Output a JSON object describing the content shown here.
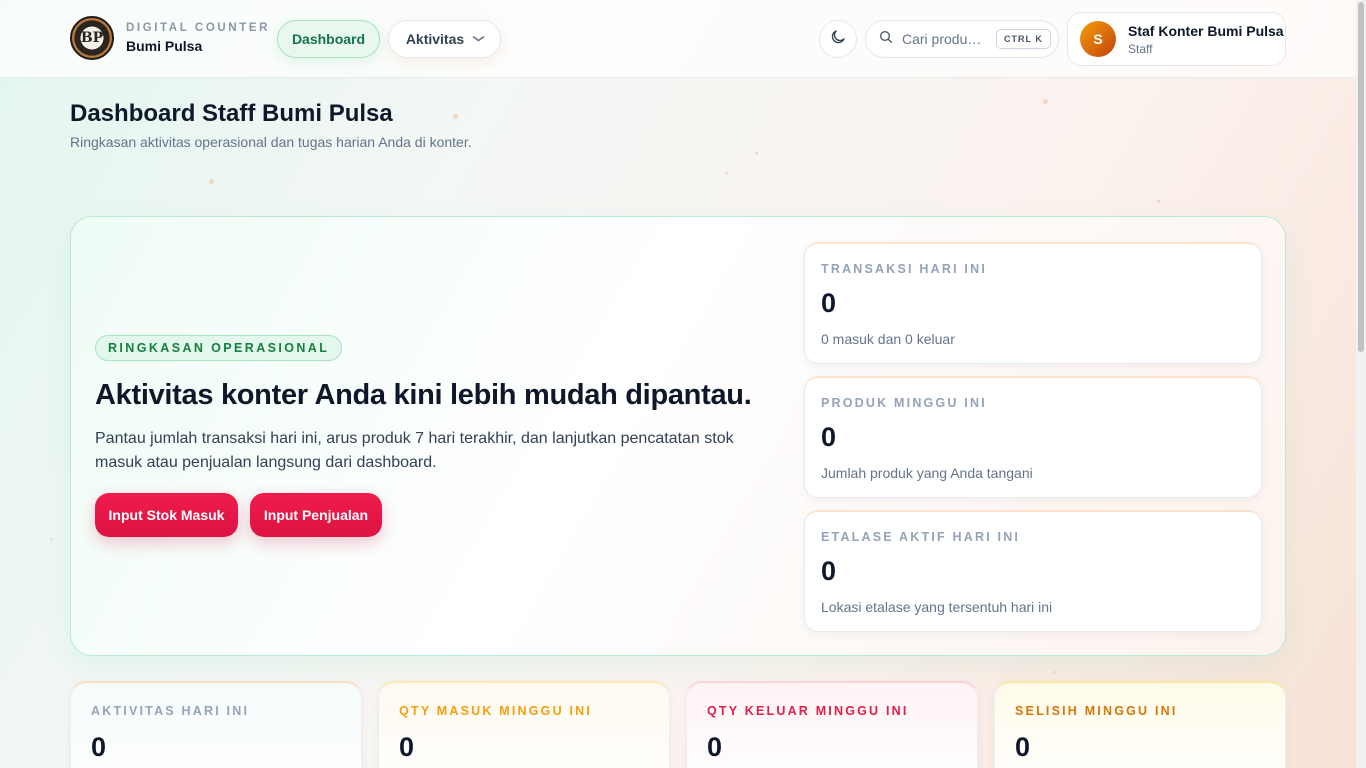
{
  "colors": {
    "accent_green": "#157347",
    "cta_red": "#e11d48",
    "card_orange": "#f59e0b",
    "card_red": "#e11d48",
    "card_amber": "#d97706"
  },
  "header": {
    "brand": {
      "logo_text": "BP",
      "subtitle": "DIGITAL COUNTER",
      "name": "Bumi Pulsa",
      "logo_icon": "bumi-pulsa-logo"
    },
    "nav": {
      "dashboard_label": "Dashboard",
      "aktivitas_label": "Aktivitas",
      "aktivitas_icon": "chevron-down-icon"
    },
    "theme_toggle_icon": "moon-icon",
    "search": {
      "icon": "search-icon",
      "placeholder": "Cari produk...",
      "shortcut": "CTRL K"
    },
    "user": {
      "avatar_initial": "S",
      "name": "Staf Konter Bumi Pulsa",
      "role": "Staff"
    }
  },
  "page": {
    "title": "Dashboard Staff Bumi Pulsa",
    "subtitle": "Ringkasan aktivitas operasional dan tugas harian Anda di konter."
  },
  "hero": {
    "badge": "RINGKASAN OPERASIONAL",
    "title": "Aktivitas konter Anda kini lebih mudah dipantau.",
    "description": "Pantau jumlah transaksi hari ini, arus produk 7 hari terakhir, dan lanjutkan pencatatan stok masuk atau penjualan langsung dari dashboard.",
    "buttons": {
      "stok_masuk": "Input Stok Masuk",
      "penjualan": "Input Penjualan"
    },
    "stats": [
      {
        "label": "TRANSAKSI HARI INI",
        "value": "0",
        "desc": "0 masuk dan 0 keluar"
      },
      {
        "label": "PRODUK MINGGU INI",
        "value": "0",
        "desc": "Jumlah produk yang Anda tangani"
      },
      {
        "label": "ETALASE AKTIF HARI INI",
        "value": "0",
        "desc": "Lokasi etalase yang tersentuh hari ini"
      }
    ]
  },
  "summary_cards": [
    {
      "label": "AKTIVITAS HARI INI",
      "value": "0"
    },
    {
      "label": "QTY MASUK MINGGU INI",
      "value": "0"
    },
    {
      "label": "QTY KELUAR MINGGU INI",
      "value": "0"
    },
    {
      "label": "SELISIH MINGGU INI",
      "value": "0"
    }
  ]
}
